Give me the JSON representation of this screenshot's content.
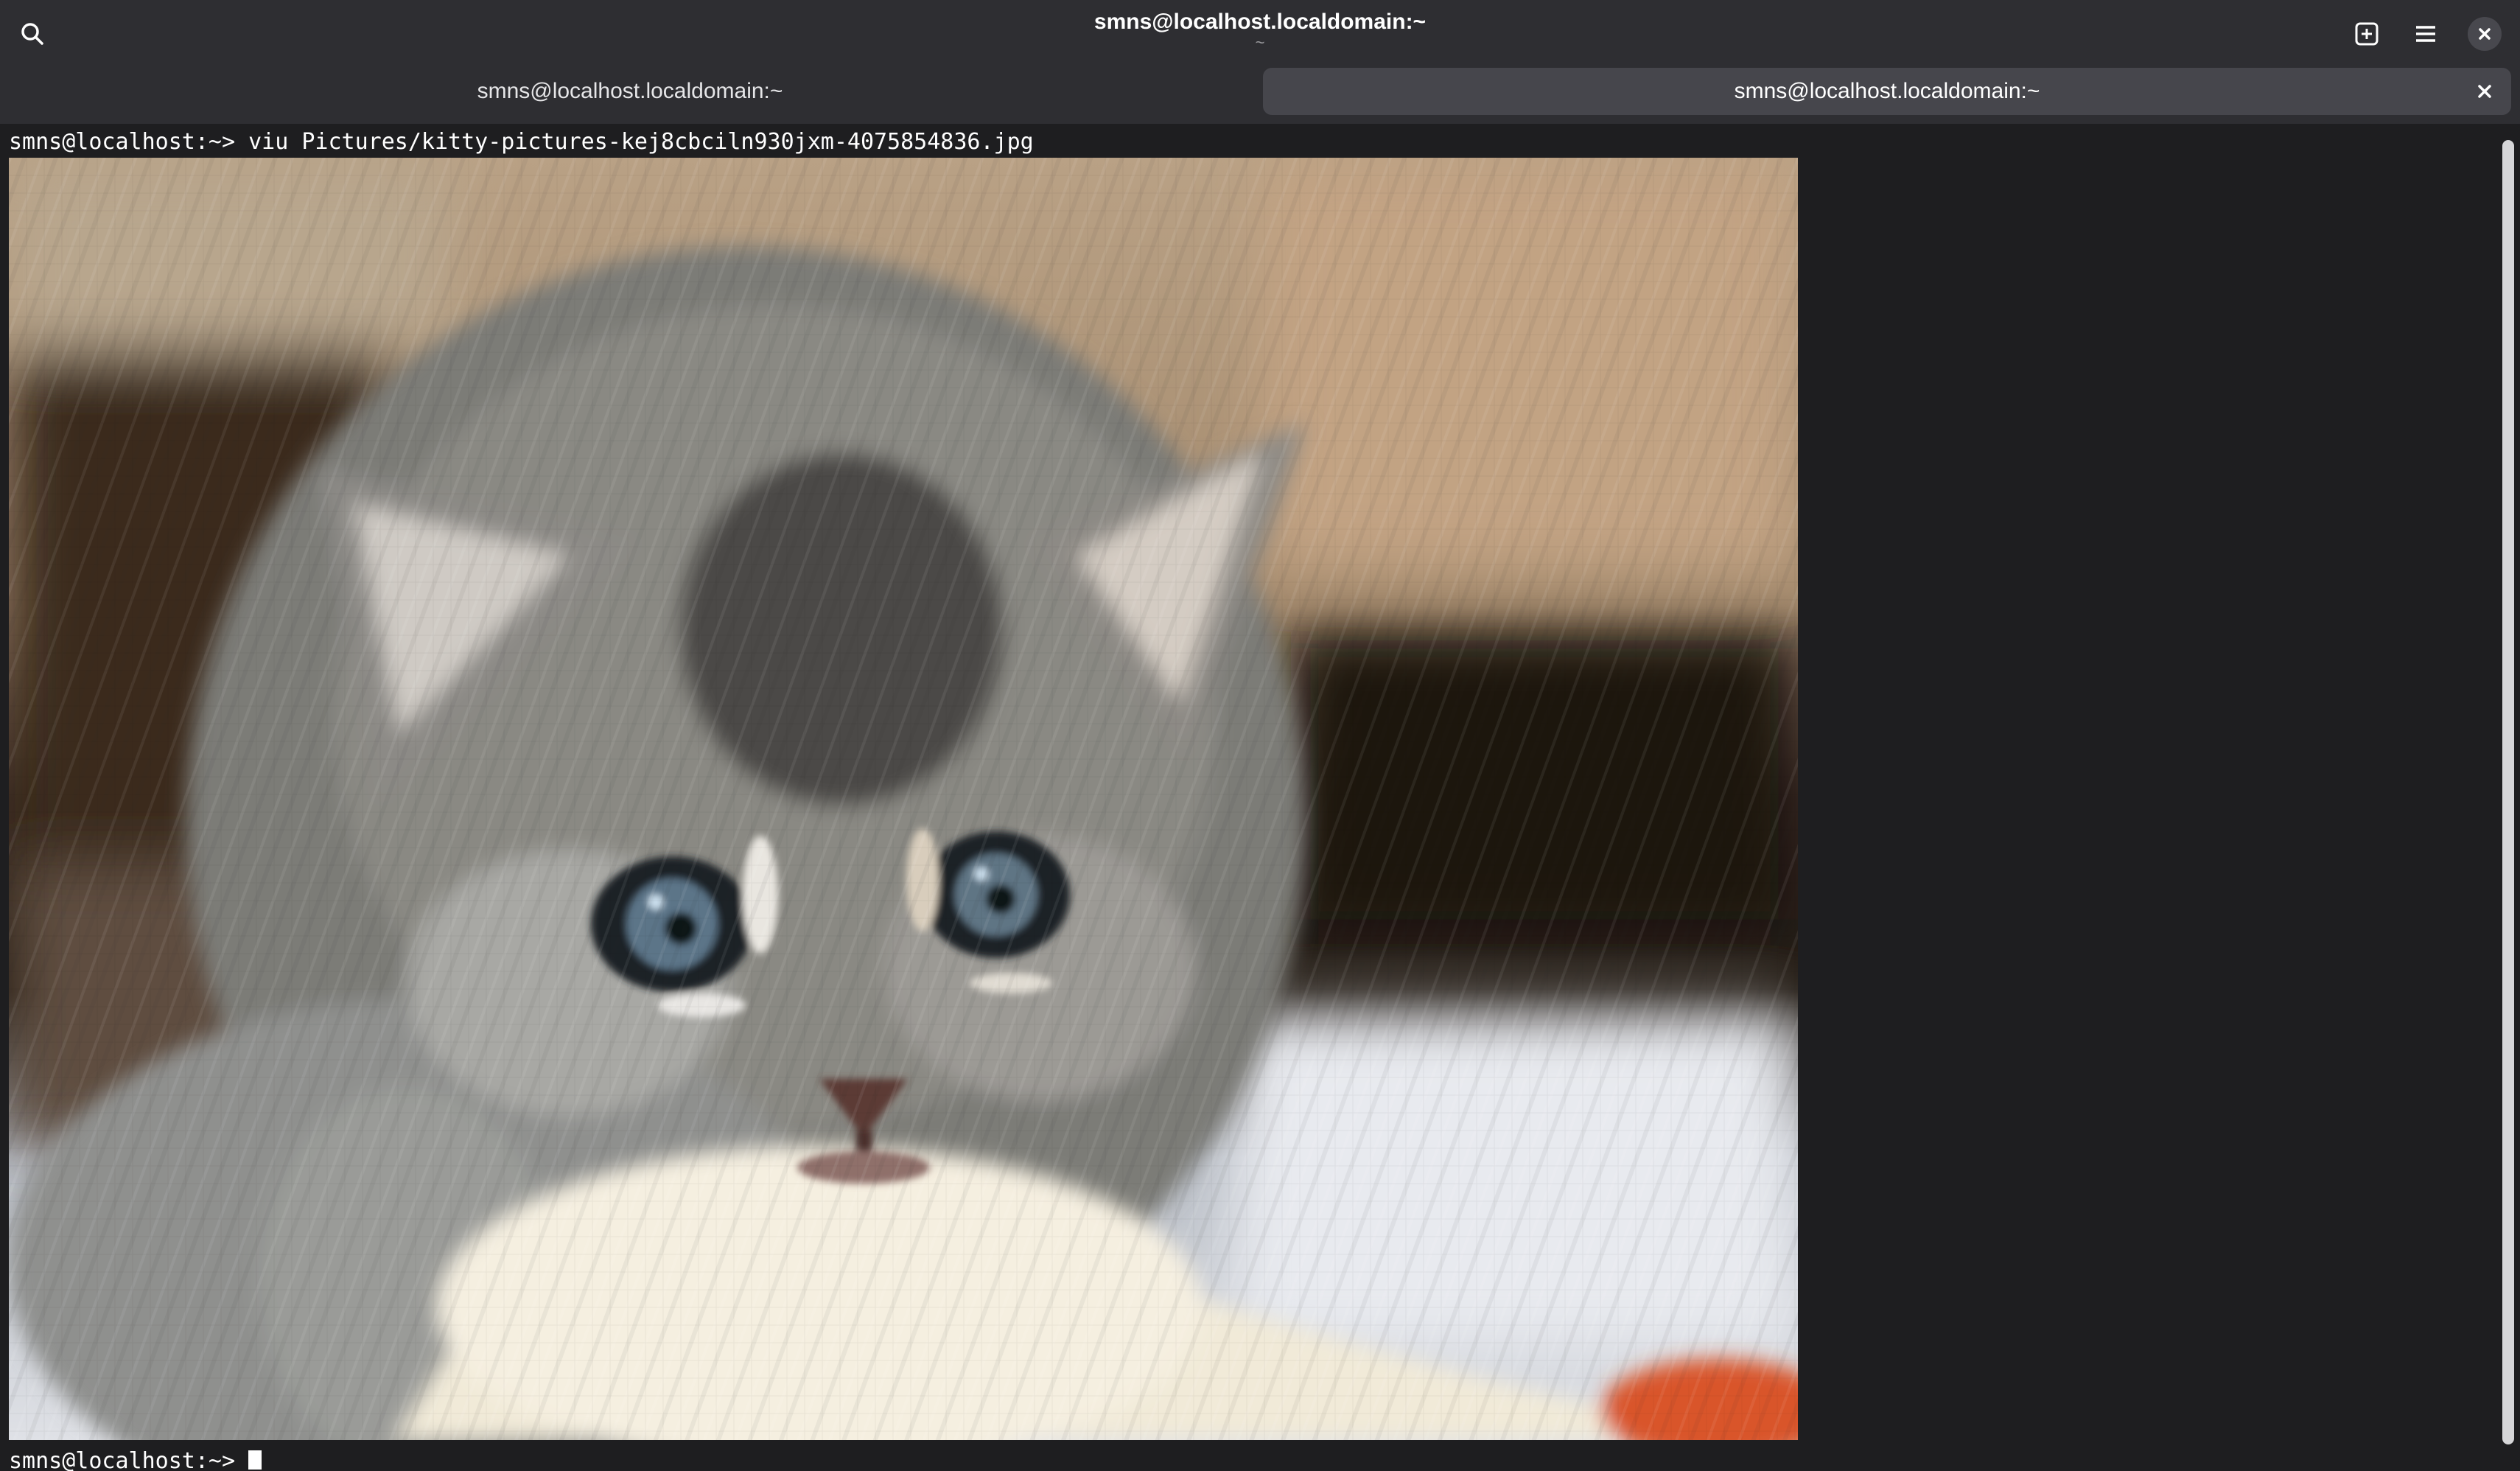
{
  "window": {
    "title": "smns@localhost.localdomain:~",
    "subtitle": "~"
  },
  "icons": {
    "search": "search-icon",
    "new_tab": "new-tab-icon",
    "menu": "hamburger-menu-icon",
    "close": "close-icon"
  },
  "tabs": [
    {
      "label": "smns@localhost.localdomain:~",
      "active": false
    },
    {
      "label": "smns@localhost.localdomain:~",
      "active": true
    }
  ],
  "terminal": {
    "command_line": "smns@localhost:~> viu Pictures/kitty-pictures-kej8cbciln930jxm-4075854836.jpg",
    "prompt_line": "smns@localhost:~> ",
    "image_description": "pixelated photo of a grey fluffy kitten"
  },
  "colors": {
    "header_bg": "#2e2e32",
    "terminal_bg": "#1e1e20",
    "active_tab_bg": "#46464c",
    "text": "#ffffff"
  }
}
